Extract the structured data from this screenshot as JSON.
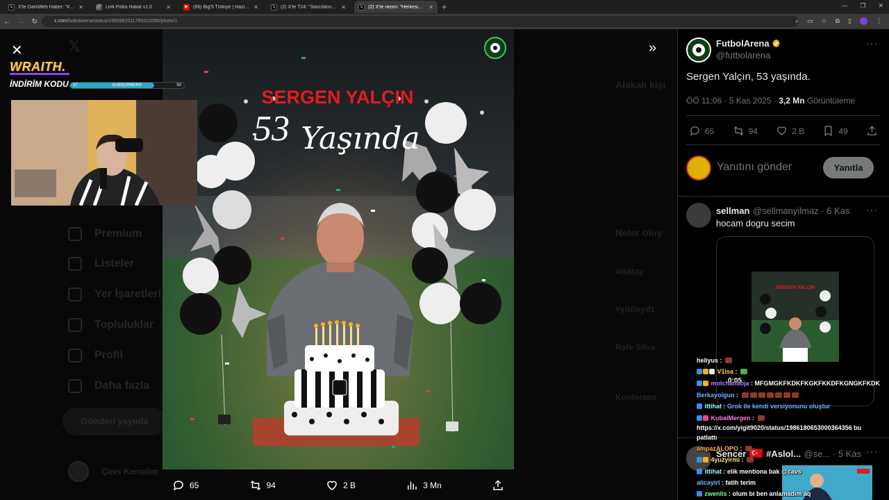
{
  "browser": {
    "tabs": [
      {
        "title": "X'te DarkWeb Haber: \"#UefaMa",
        "favicon_color": "#000000",
        "active": false
      },
      {
        "title": "Link Polisi Hakat v1.0",
        "favicon_color": "#3b3b3b",
        "active": false
      },
      {
        "title": "(66) Big'5 Türkiye | Hazırlık Sezo",
        "favicon_color": "#ff0000",
        "active": false
      },
      {
        "title": "(2) X'te T24: \"Savcıların gifresiyl",
        "favicon_color": "#000000",
        "active": false
      },
      {
        "title": "(2) X'te neom: \"Herkesin aklına...",
        "favicon_color": "#000000",
        "active": true
      }
    ],
    "url_host": "x.com",
    "url_path": "/futbolarena/status/1985982011765322050/photo/1"
  },
  "stream_overlay": {
    "brand": "WRAITH.",
    "code_label": "İNDİRİM KODU",
    "sub_label": "SUBSCRIBERS",
    "sub_current": "37",
    "sub_goal": "50",
    "sub_progress": 0.74
  },
  "photo": {
    "name_text": "SERGEN YALÇIN",
    "age_text": "53",
    "script_text": "Yaşında"
  },
  "photo_actions": {
    "replies": "65",
    "reposts": "94",
    "likes": "2 B",
    "views": "3 Mn"
  },
  "sidebar_ghost": {
    "items": [
      "Premium",
      "Listeler",
      "Yer İşaretleri",
      "Topluluklar",
      "Profil",
      "Daha fazla"
    ],
    "post_button": "Gönderi yayınla",
    "user": "Çavs Kemalım"
  },
  "right_ghost": [
    "Alakalı kişi",
    "Neler oluy",
    "#isatay",
    "#yüzleydz",
    "Rafe Silva",
    "Konferans"
  ],
  "tweet": {
    "author_name": "FutbolArena",
    "author_handle": "@futbolarena",
    "text": "Sergen Yalçın, 53 yaşında.",
    "time": "ÖÖ 11:06 · 5 Kas 2025 · ",
    "views": "3,2 Mn",
    "views_label": " Görüntüleme",
    "replies": "65",
    "reposts": "94",
    "likes": "2 B",
    "bookmarks": "49",
    "reply_placeholder": "Yanıtını gönder",
    "reply_button": "Yanıtla",
    "accent": "#1d9bf0"
  },
  "reply1": {
    "name": "sellman",
    "handle": "@sellmanyilmaz · 6 Kas",
    "text": "hocam dogru secim"
  },
  "reply2": {
    "name": "Sencer",
    "extra": "#Aslol...",
    "handle": "@se... · 5 Kas"
  },
  "chat": {
    "timer": "0:05",
    "lines": [
      {
        "user": "heliyus",
        "color": "#ffffff",
        "msg": ""
      },
      {
        "user": "V1isa",
        "color": "#ffd84d",
        "msg": ""
      },
      {
        "user": "molchanaoja",
        "color": "#b57cff",
        "msg": "MFGMGKFKDKFKGKFKKDFKGNGKFKDK"
      },
      {
        "user": "Berkayolgun",
        "color": "#6fb8ff",
        "msg": ""
      },
      {
        "user": "ittihat",
        "color": "#9ff",
        "msg": "Grok ile kendi versiyonunu oluştur"
      },
      {
        "user": "KubaiMergen",
        "color": "#ff7ad9",
        "msg": ""
      },
      {
        "user": "",
        "color": "#ffffff",
        "msg": "https://x.com/yigit9020/status/1986180653000364356 bu"
      },
      {
        "user": "",
        "color": "#ffffff",
        "msg": "patlattı"
      },
      {
        "user": "ampazALOPO",
        "color": "#ffb347",
        "msg": ""
      },
      {
        "user": "4yuzyirmi",
        "color": "#ffe066",
        "msg": ""
      },
      {
        "user": "ittihat",
        "color": "#9ff",
        "msg": "elik mentiona bak @cavs"
      },
      {
        "user": "alicayirl",
        "color": "#6fb8ff",
        "msg": "fatih terim"
      },
      {
        "user": "zwenlis",
        "color": "#7dff9a",
        "msg": "olum bi ben anlamadım aq"
      }
    ]
  }
}
